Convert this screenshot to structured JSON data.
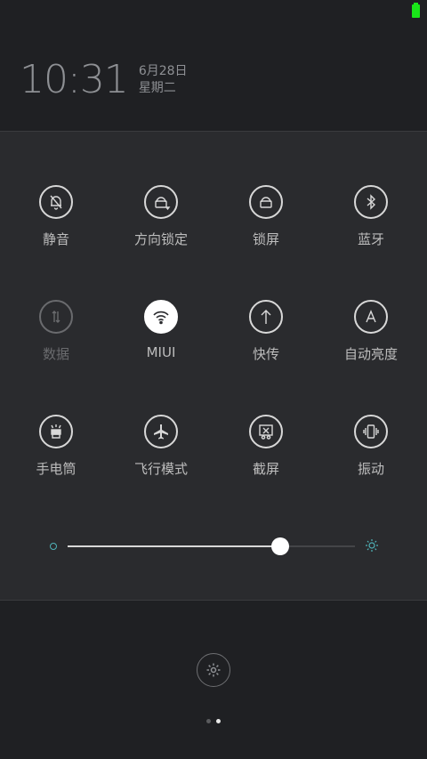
{
  "status": {
    "battery_color": "#19e619"
  },
  "lockscreen": {
    "time": "10:31",
    "date": "6月28日",
    "weekday": "星期二"
  },
  "tiles": [
    {
      "label": "静音",
      "icon": "bell-off-icon",
      "state": "normal"
    },
    {
      "label": "方向锁定",
      "icon": "rotation-lock-icon",
      "state": "normal"
    },
    {
      "label": "锁屏",
      "icon": "lock-icon",
      "state": "normal"
    },
    {
      "label": "蓝牙",
      "icon": "bluetooth-icon",
      "state": "normal"
    },
    {
      "label": "数据",
      "icon": "mobile-data-icon",
      "state": "dim"
    },
    {
      "label": "MIUI",
      "icon": "wifi-icon",
      "state": "active"
    },
    {
      "label": "快传",
      "icon": "arrow-up-icon",
      "state": "normal"
    },
    {
      "label": "自动亮度",
      "icon": "auto-brightness-icon",
      "state": "normal"
    },
    {
      "label": "手电筒",
      "icon": "flashlight-icon",
      "state": "normal"
    },
    {
      "label": "飞行模式",
      "icon": "airplane-icon",
      "state": "normal"
    },
    {
      "label": "截屏",
      "icon": "screenshot-icon",
      "state": "normal"
    },
    {
      "label": "振动",
      "icon": "vibrate-icon",
      "state": "normal"
    }
  ],
  "brightness": {
    "value": 0.74,
    "accent": "#4fb3b8"
  },
  "pager": {
    "current": 2,
    "total": 2
  },
  "settings": {
    "icon": "gear-icon"
  }
}
